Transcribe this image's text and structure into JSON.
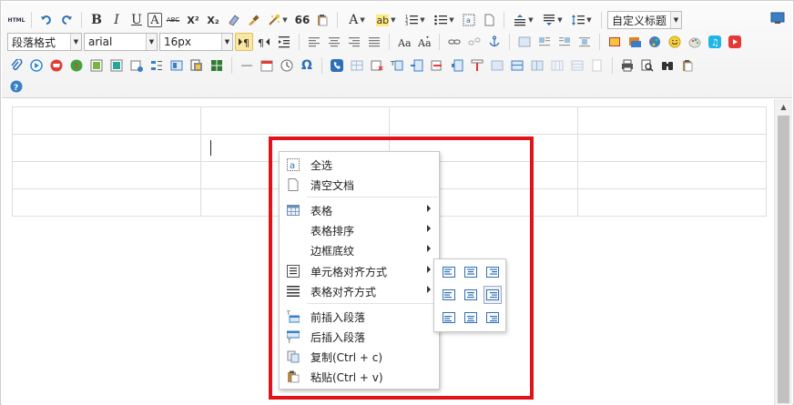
{
  "toolbar": {
    "html_label": "HTML",
    "bold": "B",
    "italic": "I",
    "underline": "U",
    "font_border": "A",
    "strike": "ABC",
    "superscript": "X²",
    "subscript": "X₂",
    "blockquote": "66",
    "forecolor": "A",
    "backcolor": "ab",
    "paragraph_select": "段落格式",
    "fontfamily_select": "arial",
    "fontsize_select": "16px",
    "custom_title_select": "自定义标题",
    "omega": "Ω",
    "accent_color": "#2d8ad8"
  },
  "context_menu": {
    "items": [
      {
        "label": "全选"
      },
      {
        "label": "清空文档"
      },
      {
        "label": "表格"
      },
      {
        "label": "表格排序"
      },
      {
        "label": "边框底纹"
      },
      {
        "label": "单元格对齐方式"
      },
      {
        "label": "表格对齐方式"
      },
      {
        "label": "前插入段落"
      },
      {
        "label": "后插入段落"
      },
      {
        "label": "复制(Ctrl + c)"
      },
      {
        "label": "粘贴(Ctrl + v)"
      }
    ]
  },
  "highlight_color": "#e0121a"
}
